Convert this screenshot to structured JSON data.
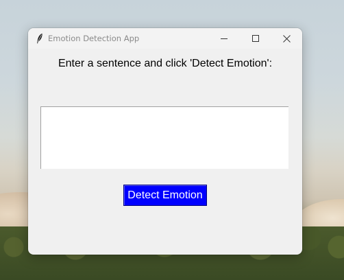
{
  "window": {
    "title": "Emotion Detection App",
    "app_icon": "feather-icon",
    "controls": {
      "minimize_icon": "minimize-icon",
      "maximize_icon": "maximize-icon",
      "close_icon": "close-icon"
    }
  },
  "main": {
    "prompt_label": "Enter a sentence and click 'Detect Emotion':",
    "input": {
      "value": "",
      "placeholder": ""
    },
    "detect_button_label": "Detect Emotion"
  },
  "colors": {
    "button_bg": "#0000ff",
    "button_text": "#ffffff",
    "window_bg": "#f0f0f0"
  }
}
